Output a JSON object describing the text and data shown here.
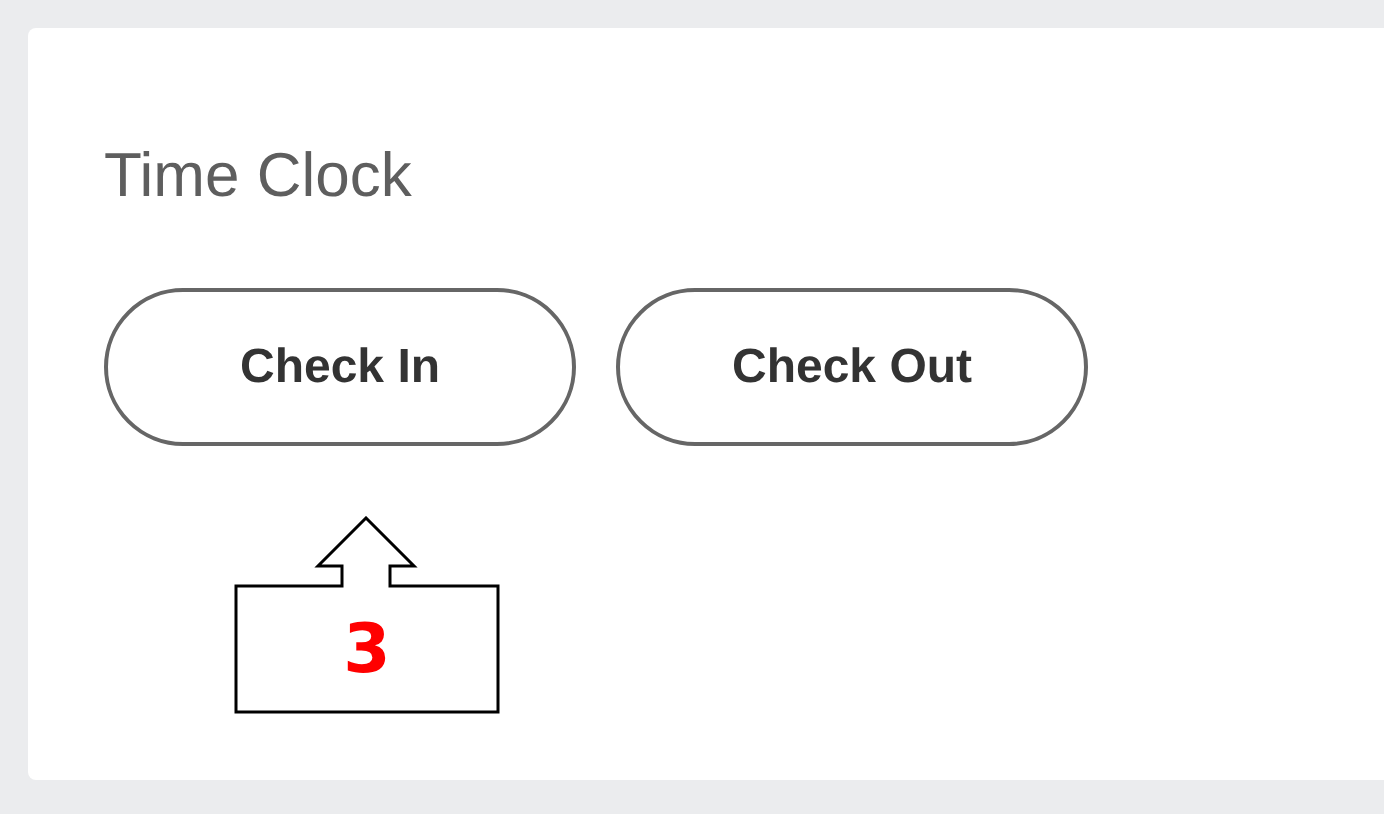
{
  "card": {
    "title": "Time Clock"
  },
  "buttons": [
    {
      "label": "Check In"
    },
    {
      "label": "Check Out"
    }
  ],
  "annotation": {
    "number": "3"
  }
}
